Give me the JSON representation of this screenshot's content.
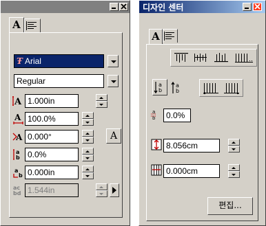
{
  "left_panel": {
    "title": "",
    "tabs": [
      {
        "label": "A",
        "icon": "character-tab"
      },
      {
        "label": "",
        "icon": "paragraph-align-icon"
      }
    ],
    "font_name": "Arial",
    "font_style": "Regular",
    "font_size": "1.000in",
    "horizontal_scale": "100.0%",
    "skew_angle": "0.000°",
    "tracking": "0.0%",
    "baseline_shift": "0.000in",
    "leading": "1.544in",
    "char_button_label": "A"
  },
  "right_panel": {
    "title": "디자인 센터",
    "tabs": [
      {
        "label": "A",
        "icon": "character-tab"
      },
      {
        "label": "",
        "icon": "paragraph-align-icon"
      }
    ],
    "spacing": "0.0%",
    "height": "8.056cm",
    "width": "0.000cm",
    "edit_button_label": "편집..."
  },
  "colors": {
    "title_active": "#0a246a",
    "title_gradient_end": "#a6caf0",
    "title_inactive": "#808080",
    "face": "#d4d0c8",
    "selection": "#0a246a",
    "close_button": "#ff3b1e"
  }
}
